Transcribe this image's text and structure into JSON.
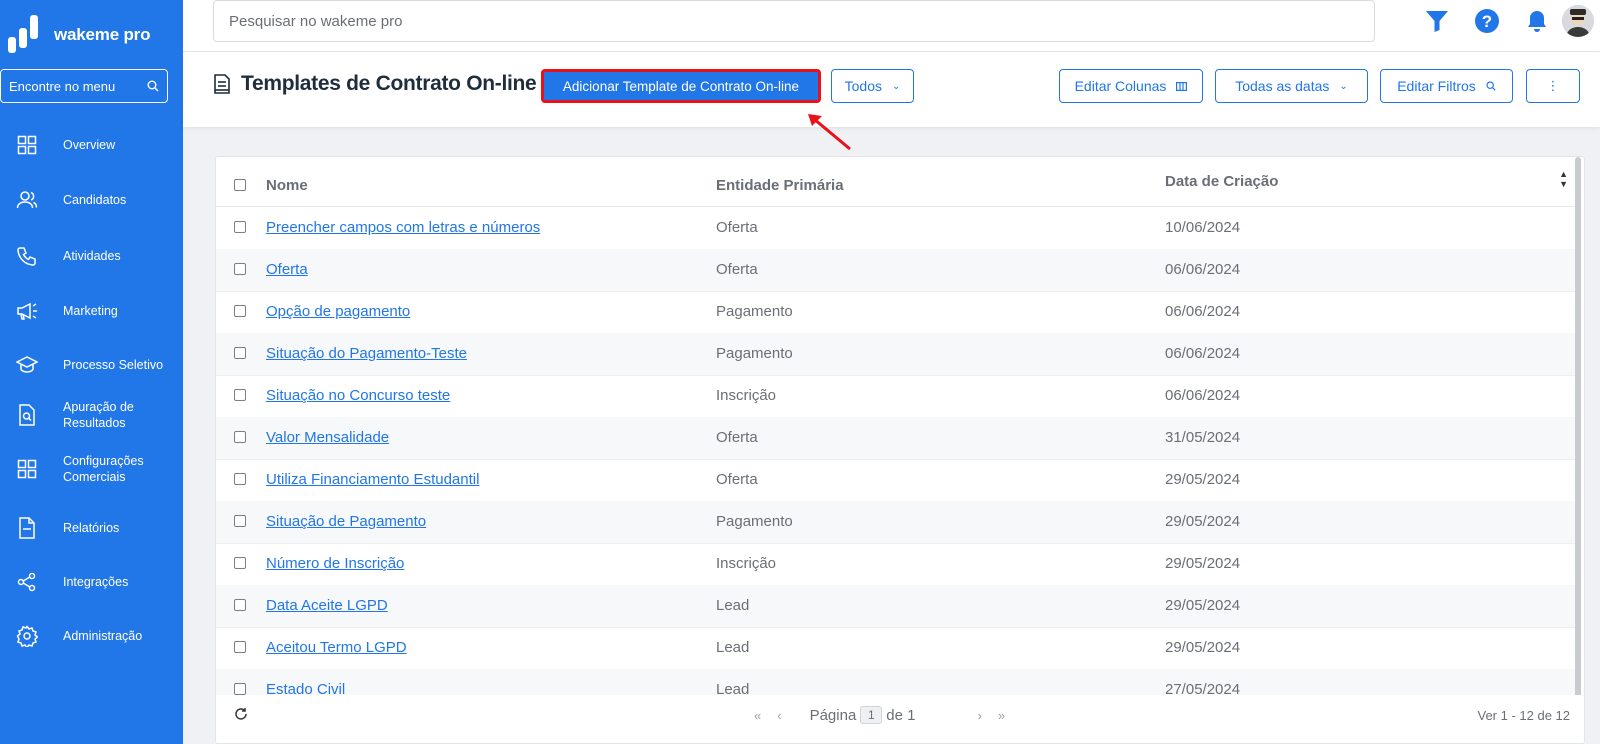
{
  "app": {
    "brand": "wakeme pro"
  },
  "sidebar": {
    "search_label": "Encontre no menu",
    "items": [
      {
        "label": "Overview",
        "icon": "grid-icon"
      },
      {
        "label": "Candidatos",
        "icon": "users-icon"
      },
      {
        "label": "Atividades",
        "icon": "phone-icon"
      },
      {
        "label": "Marketing",
        "icon": "megaphone-icon"
      },
      {
        "label": "Processo Seletivo",
        "icon": "graduation-cap-icon"
      },
      {
        "label": "Apuração de Resultados",
        "icon": "document-search-icon"
      },
      {
        "label": "Configurações Comerciais",
        "icon": "grid-icon"
      },
      {
        "label": "Relatórios",
        "icon": "report-icon"
      },
      {
        "label": "Integrações",
        "icon": "share-icon"
      },
      {
        "label": "Administração",
        "icon": "gear-icon"
      }
    ]
  },
  "topbar": {
    "search_placeholder": "Pesquisar no wakeme pro",
    "icons": [
      "filter-icon",
      "help-icon",
      "bell-icon",
      "avatar"
    ]
  },
  "header": {
    "title": "Templates de Contrato On-line",
    "add_button": "Adicionar Template de Contrato On-line",
    "filter_dropdown": "Todos",
    "edit_columns": "Editar Colunas",
    "date_dropdown": "Todas as datas",
    "edit_filters": "Editar Filtros",
    "more_menu": "⋮"
  },
  "table": {
    "columns": [
      "Nome",
      "Entidade Primária",
      "Data de Criação"
    ],
    "rows": [
      {
        "name": "Preencher campos com letras e números",
        "entity": "Oferta",
        "date": "10/06/2024"
      },
      {
        "name": "Oferta",
        "entity": "Oferta",
        "date": "06/06/2024"
      },
      {
        "name": "Opção de pagamento",
        "entity": "Pagamento",
        "date": "06/06/2024"
      },
      {
        "name": "Situação do Pagamento-Teste",
        "entity": "Pagamento",
        "date": "06/06/2024"
      },
      {
        "name": "Situação no Concurso teste",
        "entity": "Inscrição",
        "date": "06/06/2024"
      },
      {
        "name": "Valor Mensalidade",
        "entity": "Oferta",
        "date": "31/05/2024"
      },
      {
        "name": "Utiliza Financiamento Estudantil",
        "entity": "Oferta",
        "date": "29/05/2024"
      },
      {
        "name": "Situação de Pagamento",
        "entity": "Pagamento",
        "date": "29/05/2024"
      },
      {
        "name": "Número de Inscrição",
        "entity": "Inscrição",
        "date": "29/05/2024"
      },
      {
        "name": "Data Aceite LGPD",
        "entity": "Lead",
        "date": "29/05/2024"
      },
      {
        "name": "Aceitou Termo LGPD",
        "entity": "Lead",
        "date": "29/05/2024"
      },
      {
        "name": "Estado Civil",
        "entity": "Lead",
        "date": "27/05/2024"
      }
    ]
  },
  "footer": {
    "page_label": "Página",
    "page_current": "1",
    "page_of": "de 1",
    "records": "Ver 1 - 12 de 12"
  },
  "colors": {
    "primary": "#2176e8",
    "highlight": "#e8121b",
    "text_muted": "#6a6f76"
  }
}
